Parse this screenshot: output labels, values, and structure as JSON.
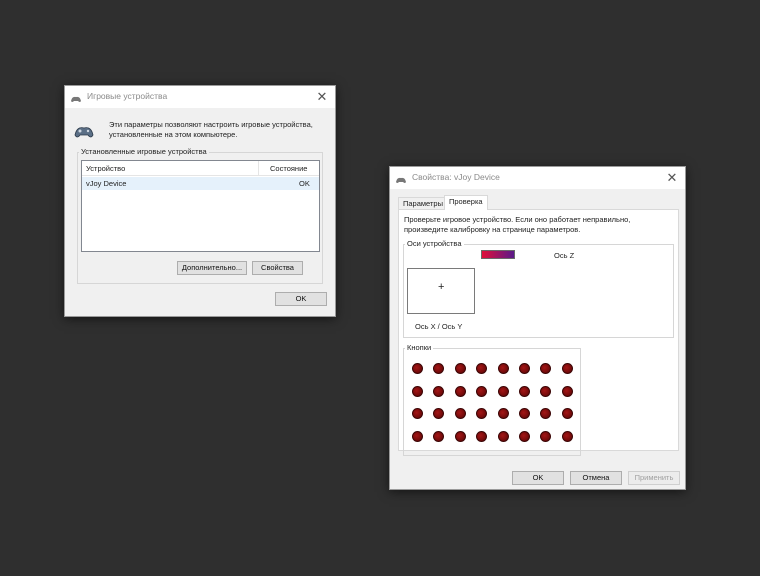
{
  "dialog1": {
    "title": "Игровые устройства",
    "description_line1": "Эти параметры позволяют настроить игровые устройства,",
    "description_line2": "установленные на этом компьютере.",
    "group_label": "Установленные игровые устройства",
    "columns": {
      "device": "Устройство",
      "status": "Состояние"
    },
    "rows": [
      {
        "device": "vJoy Device",
        "status": "OK"
      }
    ],
    "advanced_button": "Дополнительно...",
    "properties_button": "Свойства",
    "ok_button": "OK",
    "close_glyph": "✕"
  },
  "dialog2": {
    "title": "Свойства: vJoy Device",
    "tabs": [
      {
        "label": "Параметры",
        "active": false
      },
      {
        "label": "Проверка",
        "active": true
      }
    ],
    "info_line1": "Проверьте игровое устройство. Если оно работает неправильно,",
    "info_line2": "произведите калибровку на странице параметров.",
    "axes_group_label": "Оси устройства",
    "z_axis_label": "Ось Z",
    "xy_axis_label": "Ось X / Ось Y",
    "crosshair_glyph": "+",
    "buttons_group_label": "Кнопки",
    "button_led_rows": 4,
    "button_led_cols": 8,
    "ok_button": "OK",
    "cancel_button": "Отмена",
    "apply_button": "Применить",
    "apply_enabled": false,
    "close_glyph": "✕",
    "z_bar_colors": [
      "#e0103a",
      "#5a1a8a"
    ]
  }
}
